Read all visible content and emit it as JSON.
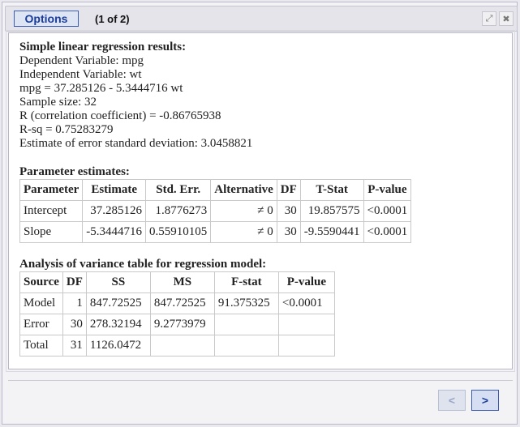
{
  "toolbar": {
    "options_label": "Options",
    "page_indicator": "(1 of 2)",
    "maximize_icon": "⤢",
    "close_icon": "✖"
  },
  "results": {
    "title": "Simple linear regression results:",
    "lines": [
      "Dependent Variable: mpg",
      "Independent Variable: wt",
      "mpg = 37.285126 - 5.3444716 wt",
      "Sample size: 32",
      "R (correlation coefficient) = -0.86765938",
      "R-sq = 0.75283279",
      "Estimate of error standard deviation: 3.0458821"
    ]
  },
  "param_table": {
    "title": "Parameter estimates:",
    "headers": [
      "Parameter",
      "Estimate",
      "Std. Err.",
      "Alternative",
      "DF",
      "T-Stat",
      "P-value"
    ],
    "rows": [
      [
        "Intercept",
        "37.285126",
        "1.8776273",
        "≠ 0",
        "30",
        "19.857575",
        "<0.0001"
      ],
      [
        "Slope",
        "-5.3444716",
        "0.55910105",
        "≠ 0",
        "30",
        "-9.5590441",
        "<0.0001"
      ]
    ]
  },
  "anova_table": {
    "title": "Analysis of variance table for regression model:",
    "headers": [
      "Source",
      "DF",
      "SS",
      "MS",
      "F-stat",
      "P-value"
    ],
    "rows": [
      [
        "Model",
        "1",
        "847.72525",
        "847.72525",
        "91.375325",
        "<0.0001"
      ],
      [
        "Error",
        "30",
        "278.32194",
        "9.2773979",
        "",
        ""
      ],
      [
        "Total",
        "31",
        "1126.0472",
        "",
        "",
        ""
      ]
    ]
  },
  "nav": {
    "prev_label": "<",
    "next_label": ">"
  }
}
